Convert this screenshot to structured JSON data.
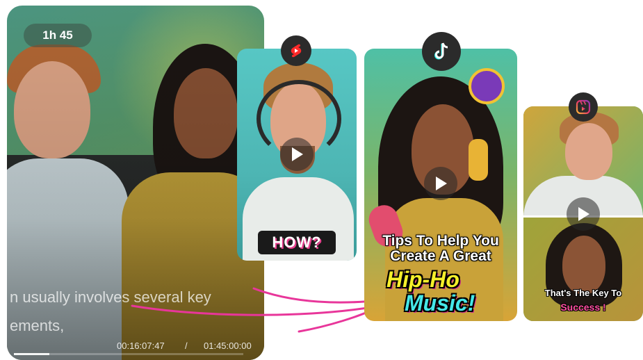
{
  "main_video": {
    "duration_badge": "1h 45",
    "subtitle_line1": "n usually involves several key",
    "subtitle_line2": "ements,",
    "current_time": "00:16:07:47",
    "separator": "/",
    "total_time": "01:45:00:00",
    "progress_fraction": 0.154
  },
  "clips": {
    "youtube": {
      "platform_icon": "youtube-shorts-icon",
      "caption": "HOW?"
    },
    "tiktok": {
      "platform_icon": "tiktok-icon",
      "caption_line1": "Tips To Help You",
      "caption_line2": "Create A Great",
      "caption_line3": "Hip-Ho",
      "caption_line4": "Music!"
    },
    "instagram": {
      "platform_icon": "instagram-reels-icon",
      "caption_line1": "That's The Key To",
      "caption_line2": "Success !"
    }
  },
  "colors": {
    "arrow": "#e8369a",
    "hip_text": "#f5ef2a",
    "music_text": "#45e7e8",
    "success_text": "#ff4fa3"
  }
}
